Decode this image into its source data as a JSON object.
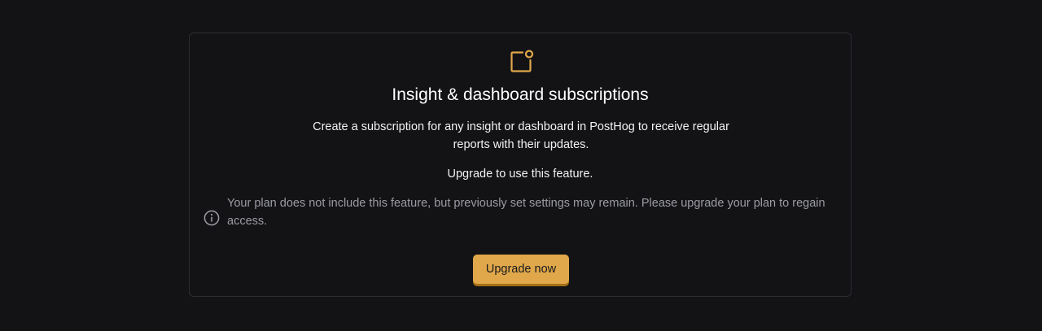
{
  "colors": {
    "background": "#131316",
    "card_border": "#2c2d33",
    "accent": "#e0a84a",
    "muted_text": "#9b9ca3"
  },
  "feature": {
    "icon": "subscription-bell-square-icon",
    "title": "Insight & dashboard subscriptions",
    "description": "Create a subscription for any insight or dashboard in PostHog to receive regular reports with their updates.",
    "upgrade_text": "Upgrade to use this feature."
  },
  "notice": {
    "icon": "info-icon",
    "text": "Your plan does not include this feature, but previously set settings may remain. Please upgrade your plan to regain access."
  },
  "actions": {
    "upgrade_label": "Upgrade now"
  }
}
